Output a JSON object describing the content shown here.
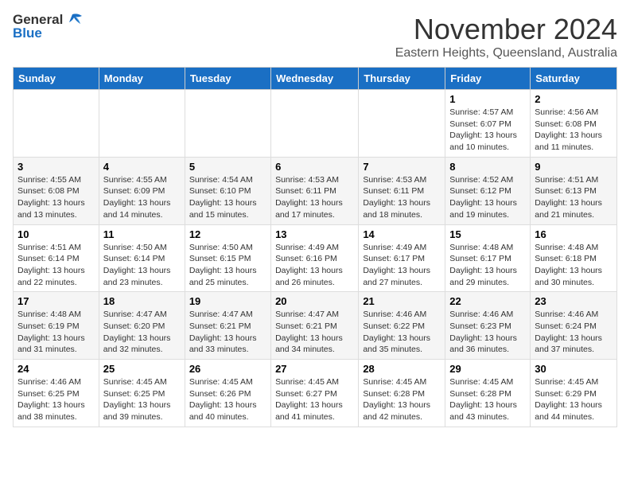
{
  "header": {
    "logo_general": "General",
    "logo_blue": "Blue",
    "month": "November 2024",
    "location": "Eastern Heights, Queensland, Australia"
  },
  "weekdays": [
    "Sunday",
    "Monday",
    "Tuesday",
    "Wednesday",
    "Thursday",
    "Friday",
    "Saturday"
  ],
  "weeks": [
    [
      {
        "day": "",
        "info": ""
      },
      {
        "day": "",
        "info": ""
      },
      {
        "day": "",
        "info": ""
      },
      {
        "day": "",
        "info": ""
      },
      {
        "day": "",
        "info": ""
      },
      {
        "day": "1",
        "info": "Sunrise: 4:57 AM\nSunset: 6:07 PM\nDaylight: 13 hours and 10 minutes."
      },
      {
        "day": "2",
        "info": "Sunrise: 4:56 AM\nSunset: 6:08 PM\nDaylight: 13 hours and 11 minutes."
      }
    ],
    [
      {
        "day": "3",
        "info": "Sunrise: 4:55 AM\nSunset: 6:08 PM\nDaylight: 13 hours and 13 minutes."
      },
      {
        "day": "4",
        "info": "Sunrise: 4:55 AM\nSunset: 6:09 PM\nDaylight: 13 hours and 14 minutes."
      },
      {
        "day": "5",
        "info": "Sunrise: 4:54 AM\nSunset: 6:10 PM\nDaylight: 13 hours and 15 minutes."
      },
      {
        "day": "6",
        "info": "Sunrise: 4:53 AM\nSunset: 6:11 PM\nDaylight: 13 hours and 17 minutes."
      },
      {
        "day": "7",
        "info": "Sunrise: 4:53 AM\nSunset: 6:11 PM\nDaylight: 13 hours and 18 minutes."
      },
      {
        "day": "8",
        "info": "Sunrise: 4:52 AM\nSunset: 6:12 PM\nDaylight: 13 hours and 19 minutes."
      },
      {
        "day": "9",
        "info": "Sunrise: 4:51 AM\nSunset: 6:13 PM\nDaylight: 13 hours and 21 minutes."
      }
    ],
    [
      {
        "day": "10",
        "info": "Sunrise: 4:51 AM\nSunset: 6:14 PM\nDaylight: 13 hours and 22 minutes."
      },
      {
        "day": "11",
        "info": "Sunrise: 4:50 AM\nSunset: 6:14 PM\nDaylight: 13 hours and 23 minutes."
      },
      {
        "day": "12",
        "info": "Sunrise: 4:50 AM\nSunset: 6:15 PM\nDaylight: 13 hours and 25 minutes."
      },
      {
        "day": "13",
        "info": "Sunrise: 4:49 AM\nSunset: 6:16 PM\nDaylight: 13 hours and 26 minutes."
      },
      {
        "day": "14",
        "info": "Sunrise: 4:49 AM\nSunset: 6:17 PM\nDaylight: 13 hours and 27 minutes."
      },
      {
        "day": "15",
        "info": "Sunrise: 4:48 AM\nSunset: 6:17 PM\nDaylight: 13 hours and 29 minutes."
      },
      {
        "day": "16",
        "info": "Sunrise: 4:48 AM\nSunset: 6:18 PM\nDaylight: 13 hours and 30 minutes."
      }
    ],
    [
      {
        "day": "17",
        "info": "Sunrise: 4:48 AM\nSunset: 6:19 PM\nDaylight: 13 hours and 31 minutes."
      },
      {
        "day": "18",
        "info": "Sunrise: 4:47 AM\nSunset: 6:20 PM\nDaylight: 13 hours and 32 minutes."
      },
      {
        "day": "19",
        "info": "Sunrise: 4:47 AM\nSunset: 6:21 PM\nDaylight: 13 hours and 33 minutes."
      },
      {
        "day": "20",
        "info": "Sunrise: 4:47 AM\nSunset: 6:21 PM\nDaylight: 13 hours and 34 minutes."
      },
      {
        "day": "21",
        "info": "Sunrise: 4:46 AM\nSunset: 6:22 PM\nDaylight: 13 hours and 35 minutes."
      },
      {
        "day": "22",
        "info": "Sunrise: 4:46 AM\nSunset: 6:23 PM\nDaylight: 13 hours and 36 minutes."
      },
      {
        "day": "23",
        "info": "Sunrise: 4:46 AM\nSunset: 6:24 PM\nDaylight: 13 hours and 37 minutes."
      }
    ],
    [
      {
        "day": "24",
        "info": "Sunrise: 4:46 AM\nSunset: 6:25 PM\nDaylight: 13 hours and 38 minutes."
      },
      {
        "day": "25",
        "info": "Sunrise: 4:45 AM\nSunset: 6:25 PM\nDaylight: 13 hours and 39 minutes."
      },
      {
        "day": "26",
        "info": "Sunrise: 4:45 AM\nSunset: 6:26 PM\nDaylight: 13 hours and 40 minutes."
      },
      {
        "day": "27",
        "info": "Sunrise: 4:45 AM\nSunset: 6:27 PM\nDaylight: 13 hours and 41 minutes."
      },
      {
        "day": "28",
        "info": "Sunrise: 4:45 AM\nSunset: 6:28 PM\nDaylight: 13 hours and 42 minutes."
      },
      {
        "day": "29",
        "info": "Sunrise: 4:45 AM\nSunset: 6:28 PM\nDaylight: 13 hours and 43 minutes."
      },
      {
        "day": "30",
        "info": "Sunrise: 4:45 AM\nSunset: 6:29 PM\nDaylight: 13 hours and 44 minutes."
      }
    ]
  ]
}
